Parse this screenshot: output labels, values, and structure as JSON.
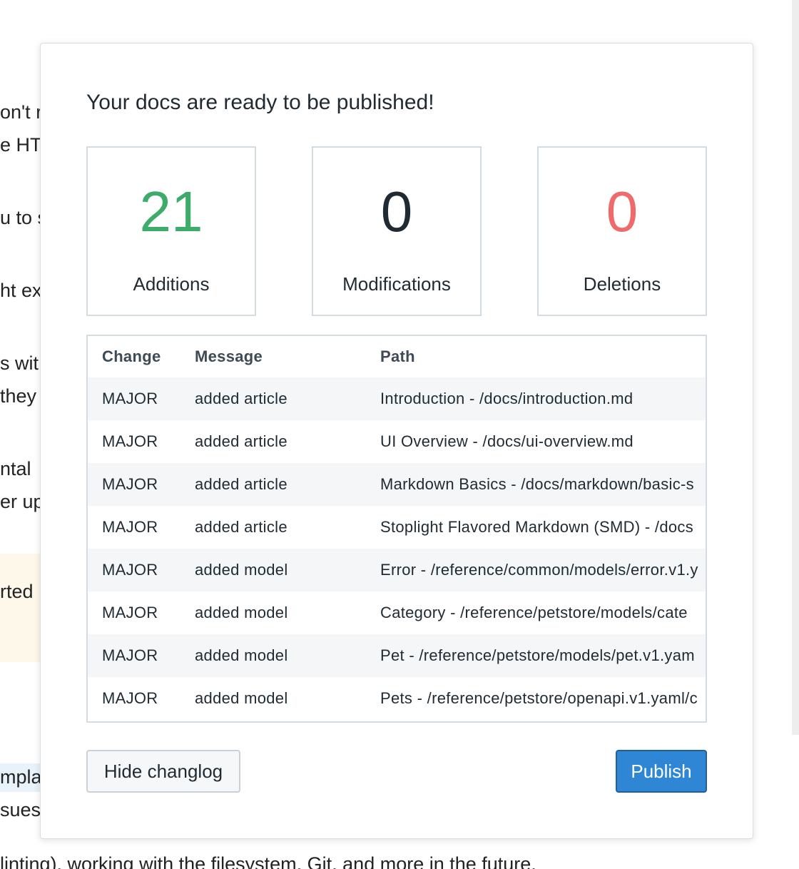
{
  "background": {
    "fragments": [
      "on't r",
      "e HT",
      "u to s",
      "ht ex",
      "s wit",
      " they",
      "ntal",
      "er up",
      "rted",
      "mpla",
      "sues"
    ],
    "bottom_line": "linting), working with the filesystem, Git, and more in the future."
  },
  "modal": {
    "title": "Your docs are ready to be published!",
    "stats": [
      {
        "value": "21",
        "label": "Additions",
        "color": "#3dac6a"
      },
      {
        "value": "0",
        "label": "Modifications",
        "color": "#1f2a33"
      },
      {
        "value": "0",
        "label": "Deletions",
        "color": "#ef6a6a"
      }
    ],
    "table": {
      "headers": [
        "Change",
        "Message",
        "Path"
      ],
      "rows": [
        [
          "MAJOR",
          "added article",
          "Introduction - /docs/introduction.md"
        ],
        [
          "MAJOR",
          "added article",
          "UI Overview - /docs/ui-overview.md"
        ],
        [
          "MAJOR",
          "added article",
          "Markdown Basics - /docs/markdown/basic-s"
        ],
        [
          "MAJOR",
          "added article",
          "Stoplight Flavored Markdown (SMD) - /docs"
        ],
        [
          "MAJOR",
          "added model",
          "Error - /reference/common/models/error.v1.y"
        ],
        [
          "MAJOR",
          "added model",
          "Category - /reference/petstore/models/cate"
        ],
        [
          "MAJOR",
          "added model",
          "Pet - /reference/petstore/models/pet.v1.yam"
        ],
        [
          "MAJOR",
          "added model",
          "Pets - /reference/petstore/openapi.v1.yaml/c"
        ]
      ]
    },
    "buttons": {
      "hide_changelog": "Hide changlog",
      "publish": "Publish"
    }
  }
}
